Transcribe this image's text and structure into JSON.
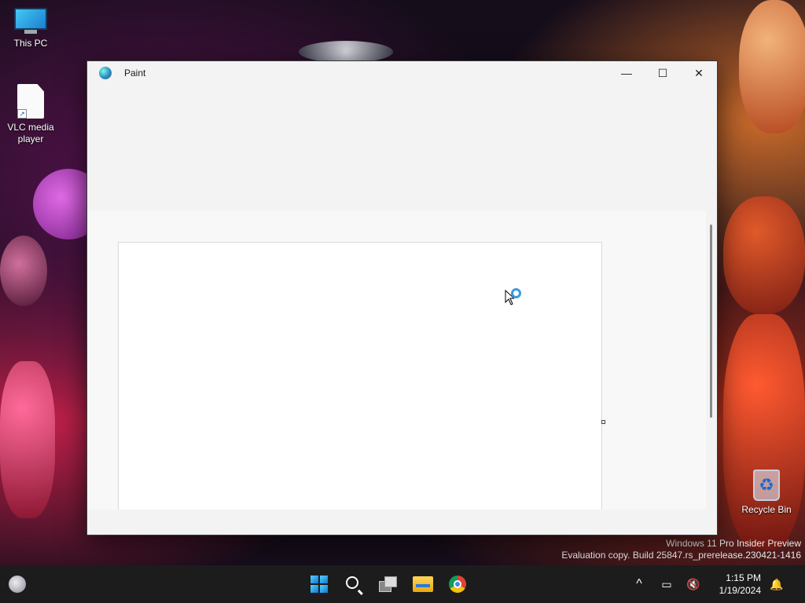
{
  "desktop": {
    "icons": [
      {
        "label": "This PC",
        "icon": "computer-icon"
      },
      {
        "label": "VLC media player",
        "icon": "file-shortcut-icon"
      },
      {
        "label": "Recycle Bin",
        "icon": "recycle-bin-icon"
      }
    ],
    "watermark": {
      "line1": "Windows 11 Pro Insider Preview",
      "line2": "Evaluation copy. Build 25847.rs_prerelease.230421-1416"
    }
  },
  "window": {
    "title": "Paint",
    "app_icon": "paint-icon",
    "controls": {
      "minimize": "—",
      "maximize": "☐",
      "close": "✕"
    }
  },
  "taskbar": {
    "items": [
      "start-icon",
      "search-icon",
      "task-view-icon",
      "file-explorer-icon",
      "chrome-icon"
    ],
    "tray": {
      "chevron": "^",
      "network": "▭",
      "volume": "🔇",
      "time": "1:15 PM",
      "date": "1/19/2024",
      "notification": "🔔"
    }
  },
  "colors": {
    "window_bg": "#f3f3f3",
    "canvas_bg": "#ffffff",
    "taskbar_bg": "#1c1c1c",
    "accent": "#0a78d4"
  }
}
